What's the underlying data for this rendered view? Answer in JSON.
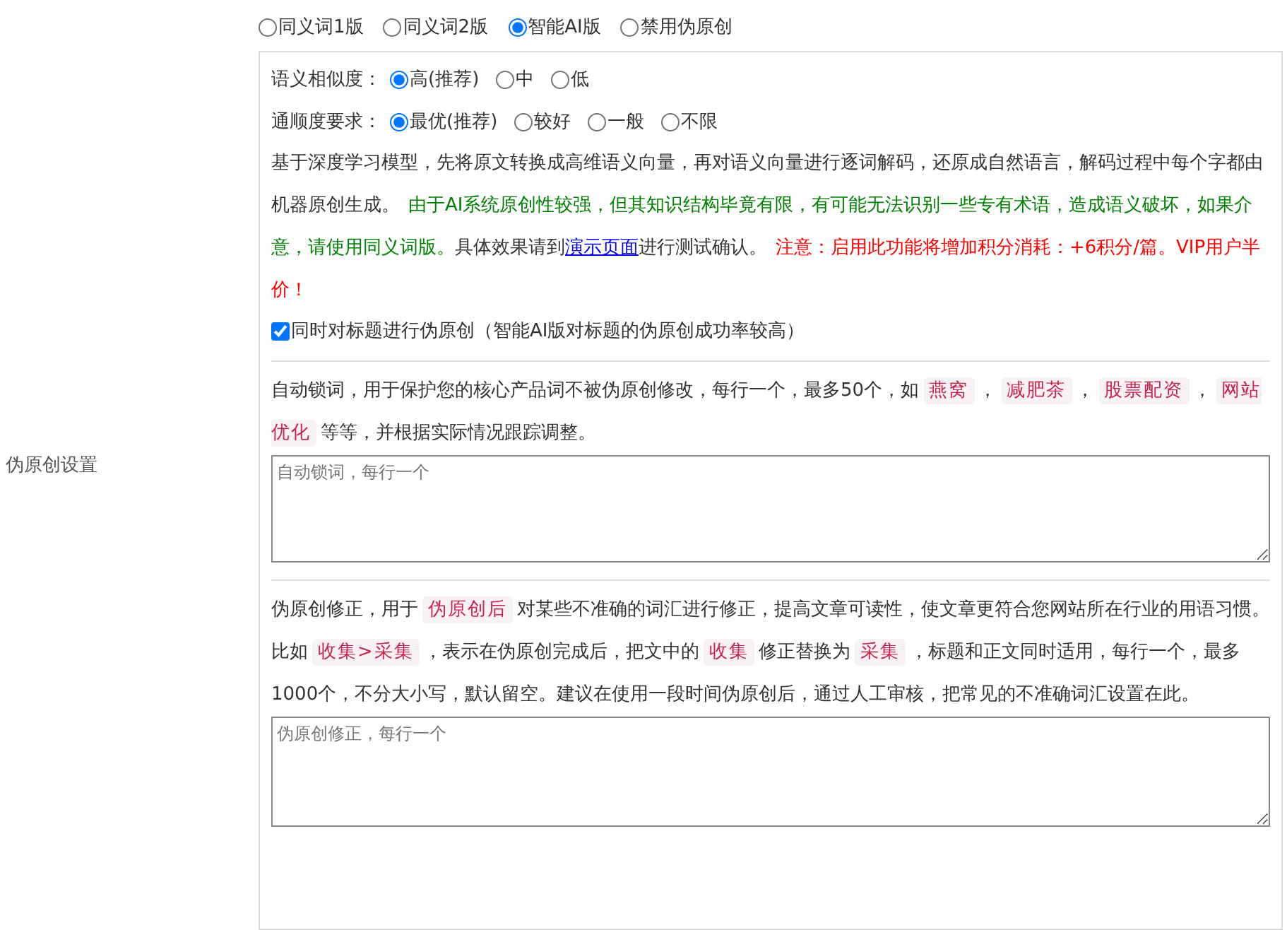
{
  "side_label": "伪原创设置",
  "mode_options": [
    {
      "label": "同义词1版",
      "selected": false
    },
    {
      "label": "同义词2版",
      "selected": false
    },
    {
      "label": "智能AI版",
      "selected": true
    },
    {
      "label": "禁用伪原创",
      "selected": false
    }
  ],
  "similarity": {
    "label": "语义相似度：",
    "options": [
      {
        "label": "高(推荐)",
        "selected": true
      },
      {
        "label": "中",
        "selected": false
      },
      {
        "label": "低",
        "selected": false
      }
    ]
  },
  "fluency": {
    "label": "通顺度要求：",
    "options": [
      {
        "label": "最优(推荐)",
        "selected": true
      },
      {
        "label": "较好",
        "selected": false
      },
      {
        "label": "一般",
        "selected": false
      },
      {
        "label": "不限",
        "selected": false
      }
    ]
  },
  "description": {
    "segments": [
      {
        "kind": "plain",
        "text": "基于深度学习模型，先将原文转换成高维语义向量，再对语义向量进行逐词解码，还原成自然语言，解码过程中每个字都由机器原创生成。"
      },
      {
        "kind": "green",
        "text": "由于AI系统原创性较强，但其知识结构毕竟有限，有可能无法识别一些专有术语，造成语义破坏，如果介意，请使用同义词版。"
      },
      {
        "kind": "plain",
        "text": "具体效果请到"
      },
      {
        "kind": "link",
        "text": "演示页面"
      },
      {
        "kind": "plain",
        "text": "进行测试确认。"
      },
      {
        "kind": "red",
        "text": "注意：启用此功能将增加积分消耗：+6积分/篇。VIP用户半价！"
      }
    ]
  },
  "title_checkbox": {
    "label": "同时对标题进行伪原创（智能AI版对标题的伪原创成功率较高）",
    "checked": true
  },
  "lock_words": {
    "segments": [
      {
        "kind": "plain",
        "text": "自动锁词，用于保护您的核心产品词不被伪原创修改，每行一个，最多50个，如"
      },
      {
        "kind": "code",
        "text": "燕窝"
      },
      {
        "kind": "plain",
        "text": "，"
      },
      {
        "kind": "code",
        "text": "减肥茶"
      },
      {
        "kind": "plain",
        "text": "，"
      },
      {
        "kind": "code",
        "text": "股票配资"
      },
      {
        "kind": "plain",
        "text": "，"
      },
      {
        "kind": "code",
        "text": "网站优化"
      },
      {
        "kind": "plain",
        "text": "等等，并根据实际情况跟踪调整。"
      }
    ],
    "placeholder": "自动锁词，每行一个"
  },
  "corrections": {
    "segments": [
      {
        "kind": "plain",
        "text": "伪原创修正，用于"
      },
      {
        "kind": "code",
        "text": "伪原创后"
      },
      {
        "kind": "plain",
        "text": "对某些不准确的词汇进行修正，提高文章可读性，使文章更符合您网站所在行业的用语习惯。比如"
      },
      {
        "kind": "code",
        "text": "收集>采集"
      },
      {
        "kind": "plain",
        "text": "，表示在伪原创完成后，把文中的"
      },
      {
        "kind": "code",
        "text": "收集"
      },
      {
        "kind": "plain",
        "text": "修正替换为"
      },
      {
        "kind": "code",
        "text": "采集"
      },
      {
        "kind": "plain",
        "text": "，标题和正文同时适用，每行一个，最多1000个，不分大小写，默认留空。建议在使用一段时间伪原创后，通过人工审核，把常见的不准确词汇设置在此。"
      }
    ],
    "placeholder": "伪原创修正，每行一个"
  }
}
